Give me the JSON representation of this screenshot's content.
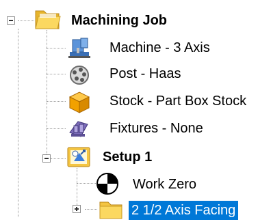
{
  "tree": {
    "root": {
      "label": "Machining Job",
      "icon": "folder-open-icon",
      "expanded": true
    },
    "children": [
      {
        "label": "Machine - 3 Axis",
        "icon": "machine-icon"
      },
      {
        "label": "Post - Haas",
        "icon": "post-processor-icon"
      },
      {
        "label": "Stock - Part Box Stock",
        "icon": "stock-box-icon"
      },
      {
        "label": "Fixtures - None",
        "icon": "fixture-icon"
      }
    ],
    "setup": {
      "label": "Setup 1",
      "icon": "setup-icon",
      "expanded": true,
      "children": [
        {
          "label": "Work Zero",
          "icon": "work-zero-icon"
        },
        {
          "label": "2 1/2 Axis Facing",
          "icon": "folder-icon",
          "selected": true,
          "expanded": false
        }
      ]
    }
  },
  "colors": {
    "selection": "#0078d7",
    "folder": "#f4c542",
    "stock": "#f2a100",
    "tree_lines": "#9a9a9a"
  }
}
